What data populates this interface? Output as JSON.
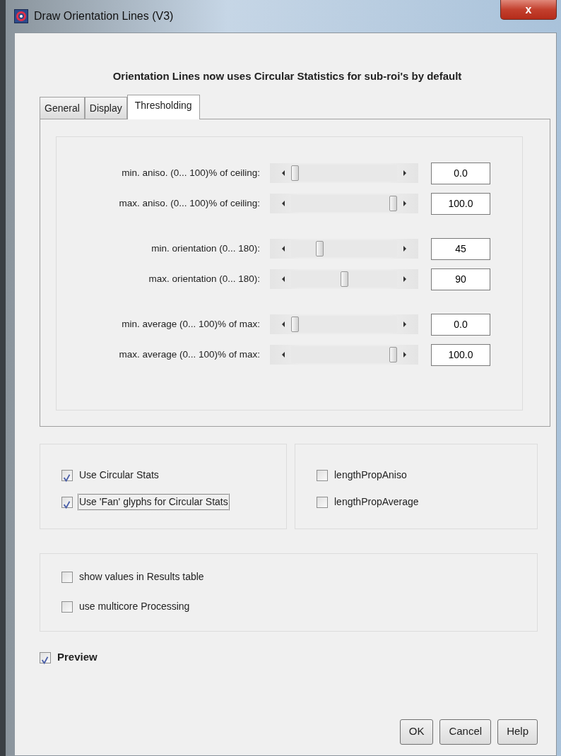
{
  "window": {
    "title": "Draw Orientation Lines (V3)",
    "close_label": "x"
  },
  "heading": "Orientation Lines now uses Circular Statistics for sub-roi's by default",
  "tabs": [
    {
      "label": "General",
      "selected": false
    },
    {
      "label": "Display",
      "selected": false
    },
    {
      "label": "Thresholding",
      "selected": true
    }
  ],
  "slider_groups": [
    [
      {
        "label": "min. aniso. (0... 100)% of ceiling:",
        "level": 0,
        "value": "0.0"
      },
      {
        "label": "max. aniso. (0... 100)% of ceiling:",
        "level": 1,
        "value": "100.0"
      }
    ],
    [
      {
        "label": "min. orientation (0... 180):",
        "level": 0.25,
        "value": "45"
      },
      {
        "label": "max. orientation (0... 180):",
        "level": 0.5,
        "value": "90"
      }
    ],
    [
      {
        "label": "min. average (0... 100)% of max:",
        "level": 0,
        "value": "0.0"
      },
      {
        "label": "max. average (0... 100)% of max:",
        "level": 1,
        "value": "100.0"
      }
    ]
  ],
  "option_panels": [
    [
      {
        "label": "Use Circular Stats",
        "checked": true,
        "focused": false
      },
      {
        "label": "Use 'Fan' glyphs for Circular Stats",
        "checked": true,
        "focused": true
      }
    ],
    [
      {
        "label": "lengthPropAniso",
        "checked": false,
        "focused": false
      },
      {
        "label": "lengthPropAverage",
        "checked": false,
        "focused": false
      }
    ]
  ],
  "extra_options": [
    {
      "label": "show values in Results table",
      "checked": false,
      "focused": false
    },
    {
      "label": "use multicore Processing",
      "checked": false,
      "focused": false
    }
  ],
  "preview": {
    "label": "Preview",
    "checked": true
  },
  "buttons": [
    "OK",
    "Cancel",
    "Help"
  ]
}
